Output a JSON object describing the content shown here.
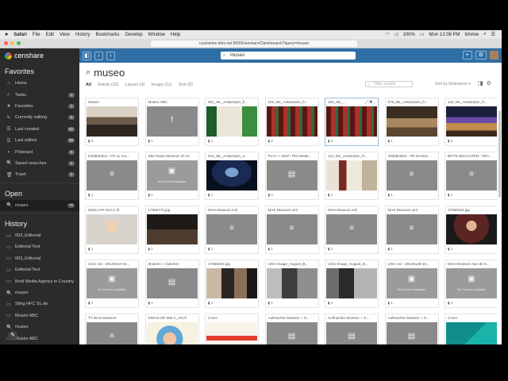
{
  "menubar": {
    "items": [
      "Safari",
      "File",
      "Edit",
      "View",
      "History",
      "Bookmarks",
      "Develop",
      "Window",
      "Help"
    ],
    "battery": "100%",
    "clock": "Mon 12:08 PM",
    "user": "timmie"
  },
  "browser": {
    "url": "customize.ldns.net:9000/censhareClient/search?query=museo"
  },
  "app": {
    "name": "censhare",
    "search_value": "museo",
    "plus_label": "+",
    "gear_label": "⚙"
  },
  "sidebar": {
    "favorites_title": "Favorites",
    "favorites": [
      {
        "label": "Home",
        "icon": "⌂",
        "badge": ""
      },
      {
        "label": "Tasks",
        "icon": "✓",
        "badge": "3"
      },
      {
        "label": "Favorites",
        "icon": "★",
        "badge": "2"
      },
      {
        "label": "Currently editing",
        "icon": "✎",
        "badge": "0"
      },
      {
        "label": "Last created",
        "icon": "☰",
        "badge": "62"
      },
      {
        "label": "Last edited",
        "icon": "☰",
        "badge": "60"
      },
      {
        "label": "Pinboard",
        "icon": "▪",
        "badge": "0"
      },
      {
        "label": "Saved searches",
        "icon": "🔍",
        "badge": "2"
      },
      {
        "label": "Trash",
        "icon": "🗑",
        "badge": "0"
      }
    ],
    "open_title": "Open",
    "open": [
      {
        "label": "museo",
        "icon": "🔍",
        "badge": "76"
      }
    ],
    "history_title": "History",
    "history": [
      {
        "label": "003_Editorial",
        "icon": "▭"
      },
      {
        "label": "Editorial Text",
        "icon": "▭"
      },
      {
        "label": "003_Editorial",
        "icon": "▭"
      },
      {
        "label": "Editorial Text",
        "icon": "▭"
      },
      {
        "label": "Brief Media Agency in Country",
        "icon": "▭"
      },
      {
        "label": "museo",
        "icon": "🔍"
      },
      {
        "label": "Sting HFC SL.de",
        "icon": "▭"
      },
      {
        "label": "Musée ABC",
        "icon": "▭"
      },
      {
        "label": "museo",
        "icon": "🔍"
      },
      {
        "label": "Musée ABC",
        "icon": "▭"
      }
    ]
  },
  "search": {
    "title": "museo",
    "filters": [
      {
        "label": "All",
        "active": true
      },
      {
        "label": "Article (32)",
        "active": false
      },
      {
        "label": "Layout (3)",
        "active": false
      },
      {
        "label": "Image (11)",
        "active": false
      },
      {
        "label": "Text (8)",
        "active": false
      }
    ],
    "filter_placeholder": "Filter results",
    "sort_label": "Sort by Relevance ▾"
  },
  "results": [
    {
      "title": "Museo",
      "kind": "photo",
      "scene": "crowd",
      "count": "3"
    },
    {
      "title": "Museo ABC",
      "kind": "icon",
      "glyph": "f",
      "count": "1"
    },
    {
      "title": "001_ML_Antwerpen_fr...",
      "kind": "photo",
      "scene": "green",
      "count": "1"
    },
    {
      "title": "102_ML_Antwerpen_fr...",
      "kind": "photo",
      "scene": "red",
      "count": "2"
    },
    {
      "title": "102_ML_...",
      "kind": "photo",
      "scene": "red",
      "count": "3",
      "hover": true
    },
    {
      "title": "076_ML_Antwerpen_fr...",
      "kind": "photo",
      "scene": "hall",
      "count": "1"
    },
    {
      "title": "115_ML_Antwerpen_fr...",
      "kind": "photo",
      "scene": "hall2",
      "count": "3"
    },
    {
      "title": "Infobbedext - FR Le mu...",
      "kind": "doc",
      "glyph": "≡",
      "count": "1"
    },
    {
      "title": "São Paulo Museum of Art",
      "kind": "noprev",
      "glyph": "▣",
      "noprev": "No Preview available",
      "count": "1"
    },
    {
      "title": "044_ML_Antwerpen_e...",
      "kind": "photo",
      "scene": "stage",
      "count": "1"
    },
    {
      "title": "PLAY + SKIP: This Week...",
      "kind": "doc",
      "glyph": "▤",
      "count": "4"
    },
    {
      "title": "112_ML_Antwerpen_fr...",
      "kind": "photo",
      "scene": "room",
      "count": "1"
    },
    {
      "title": "Infobbedext - FR Emisso...",
      "kind": "doc",
      "glyph": "≡",
      "count": "1"
    },
    {
      "title": "BITTE BEACHTEN: TIRA...",
      "kind": "doc",
      "glyph": "≡",
      "count": "1"
    },
    {
      "title": "DMSJ-HP-013 C.tif",
      "kind": "photo",
      "scene": "man",
      "count": "1"
    },
    {
      "title": "17586772.jpg",
      "kind": "photo",
      "scene": "dark",
      "count": "1"
    },
    {
      "title": "MAS Museum.xml",
      "kind": "doc",
      "glyph": "≡",
      "count": "1"
    },
    {
      "title": "MAS Museum.xml",
      "kind": "doc",
      "glyph": "≡",
      "count": "1"
    },
    {
      "title": "MAS Museum.xml",
      "kind": "doc",
      "glyph": "≡",
      "count": "1"
    },
    {
      "title": "MAS Museum.xml",
      "kind": "doc",
      "glyph": "≡",
      "count": "1"
    },
    {
      "title": "17589432.jpg",
      "kind": "photo",
      "scene": "portrait",
      "count": "1"
    },
    {
      "title": "UGC-Ad - 20120119-04...",
      "kind": "noprev",
      "glyph": "▣",
      "noprev": "No Preview available",
      "count": "1"
    },
    {
      "title": "Museen + Galerien",
      "kind": "doc",
      "glyph": "▤",
      "count": "1"
    },
    {
      "title": "17585022.jpg",
      "kind": "photo",
      "scene": "people",
      "count": "1"
    },
    {
      "title": "UGC-Image_August_B...",
      "kind": "photo",
      "scene": "bw",
      "count": "1"
    },
    {
      "title": "UGC-Image_August_B...",
      "kind": "photo",
      "scene": "bw2",
      "count": "1"
    },
    {
      "title": "UGC-Ad - 20120128-10...",
      "kind": "noprev",
      "glyph": "▣",
      "noprev": "No Preview available",
      "count": "1"
    },
    {
      "title": "MAS Museum Aan de S...",
      "kind": "noprev",
      "glyph": "▣",
      "noprev": "No Preview available",
      "count": "1"
    },
    {
      "title": "TT MAS Museum",
      "kind": "doc",
      "glyph": "≡",
      "count": ""
    },
    {
      "title": "DMAH-HP-355-A_Ab.tif",
      "kind": "photo",
      "scene": "cartoon",
      "count": ""
    },
    {
      "title": "Cover",
      "kind": "photo",
      "scene": "cover",
      "count": ""
    },
    {
      "title": "Aufmacher Museen + G...",
      "kind": "doc",
      "glyph": "▤",
      "count": ""
    },
    {
      "title": "Aufmacher Museen + G...",
      "kind": "doc",
      "glyph": "▤",
      "count": ""
    },
    {
      "title": "Aufmacher Museen + G...",
      "kind": "doc",
      "glyph": "▤",
      "count": ""
    },
    {
      "title": "Cover",
      "kind": "photo",
      "scene": "teal",
      "count": ""
    }
  ]
}
